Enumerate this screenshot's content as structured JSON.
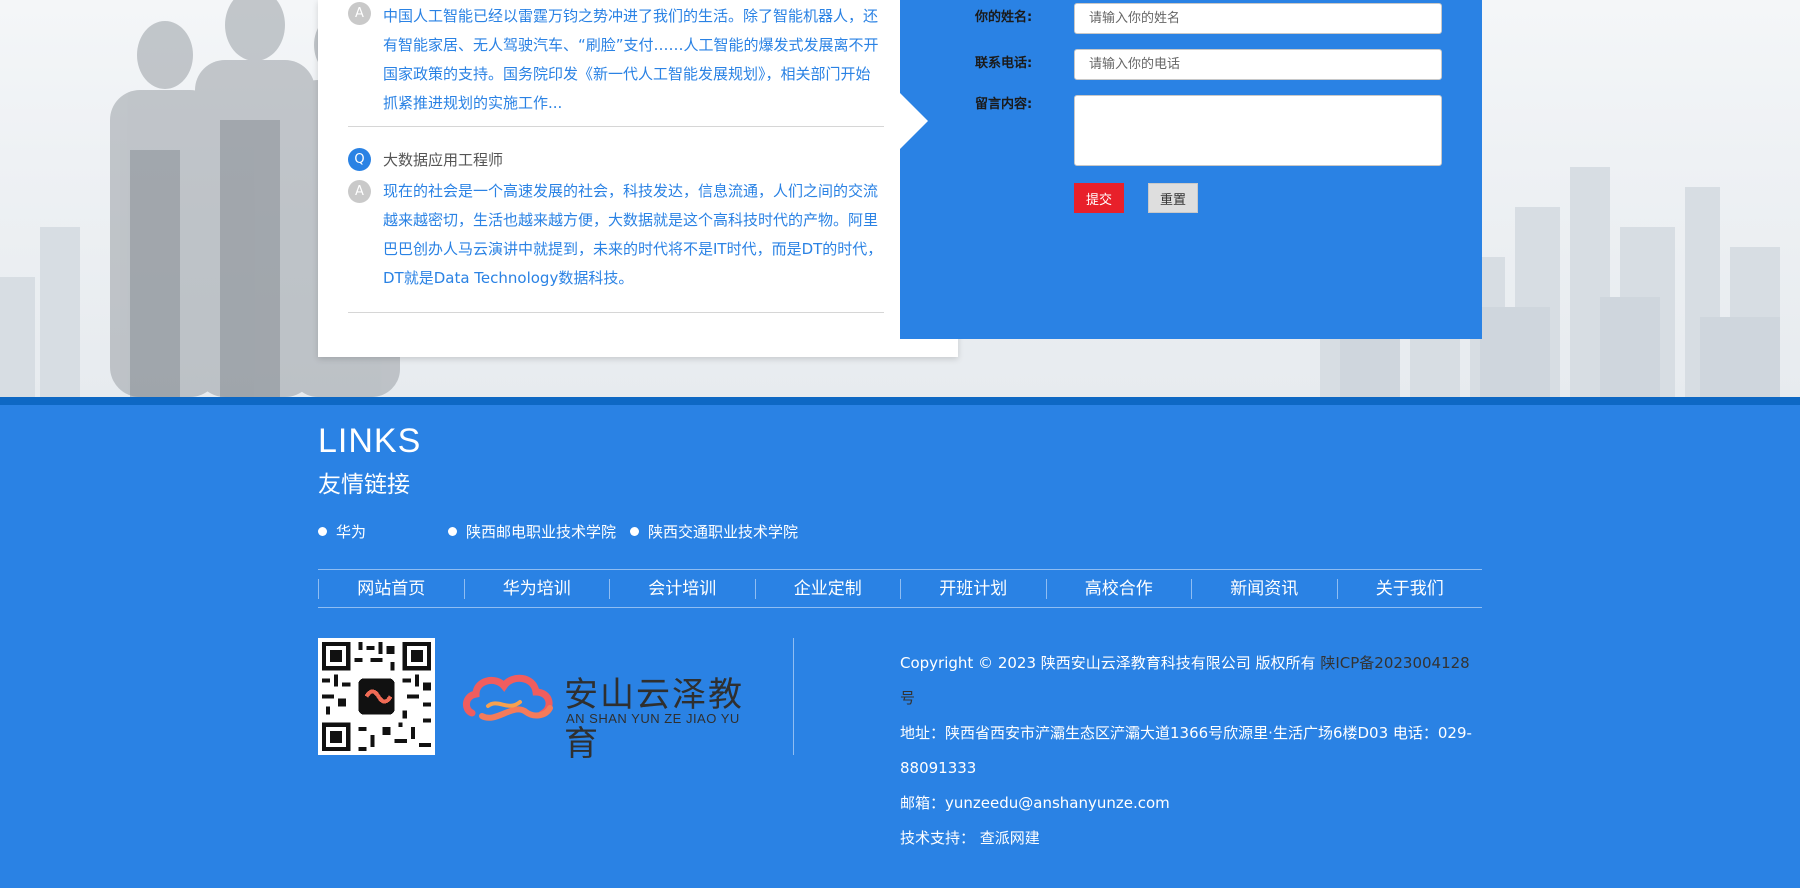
{
  "qa": {
    "item1": {
      "answer_badge": "A",
      "answer": "中国人工智能已经以雷霆万钧之势冲进了我们的生活。除了智能机器人，还有智能家居、无人驾驶汽车、“刷脸”支付……人工智能的爆发式发展离不开国家政策的支持。国务院印发《新一代人工智能发展规划》，相关部门开始抓紧推进规划的实施工作..."
    },
    "item2": {
      "question_badge": "Q",
      "question": "大数据应用工程师",
      "answer_badge": "A",
      "answer": "现在的社会是一个高速发展的社会，科技发达，信息流通，人们之间的交流越来越密切，生活也越来越方便，大数据就是这个高科技时代的产物。阿里巴巴创办人马云演讲中就提到，未来的时代将不是IT时代，而是DT的时代，DT就是Data Technology数据科技。"
    }
  },
  "form": {
    "name_label": "你的姓名:",
    "name_placeholder": "请输入你的姓名",
    "phone_label": "联系电话:",
    "phone_placeholder": "请输入你的电话",
    "message_label": "留言内容:",
    "submit_label": "提交",
    "reset_label": "重置"
  },
  "footer": {
    "links_title": "LINKS",
    "links_subtitle": "友情链接",
    "friend_links": [
      "华为",
      "陕西邮电职业技术学院",
      "陕西交通职业技术学院"
    ],
    "nav": [
      "网站首页",
      "华为培训",
      "会计培训",
      "企业定制",
      "开班计划",
      "高校合作",
      "新闻资讯",
      "关于我们"
    ],
    "logo_main": "安山云泽教育",
    "logo_sub": "AN SHAN YUN ZE JIAO YU",
    "copyright": "Copyright © 2023 陕西安山云泽教育科技有限公司 版权所有",
    "icp": "陕ICP备2023004128号",
    "address": "地址：陕西省西安市浐灞生态区浐灞大道1366号欣源里·生活广场6楼D03    电话：029-88091333",
    "email": "邮箱：yunzeedu@anshanyunze.com",
    "tech_support_label": "技术支持：",
    "tech_support_value": "查派网建"
  },
  "colors": {
    "brand_blue": "#2a82e4",
    "dark_blue_bar": "#0e68c4",
    "submit_red": "#e8202a"
  }
}
